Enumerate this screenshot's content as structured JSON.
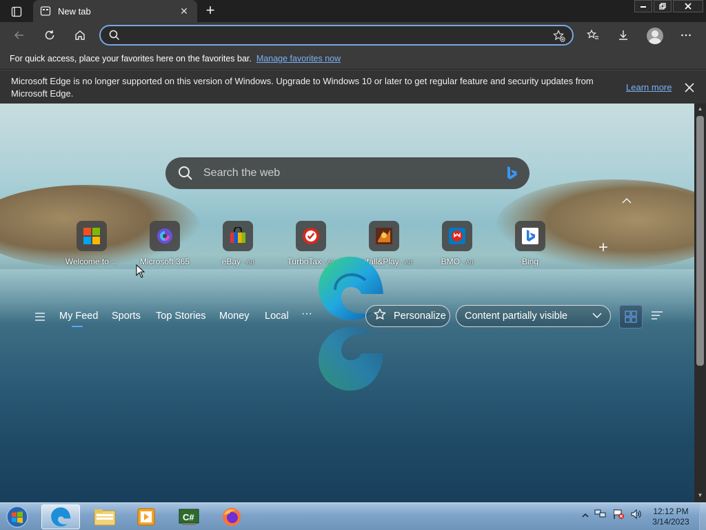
{
  "browser": {
    "tab": {
      "title": "New tab",
      "close": "✕"
    },
    "new_tab": "+",
    "window_controls": [
      "minimize",
      "restore",
      "close"
    ]
  },
  "toolbar": {
    "address_value": "",
    "icons": [
      "back-icon",
      "refresh-icon",
      "home-icon",
      "search-icon",
      "add-favorite-icon",
      "favorites-icon",
      "downloads-icon",
      "profile-avatar",
      "more-icon"
    ]
  },
  "favorites_bar": {
    "text": "For quick access, place your favorites here on the favorites bar.",
    "link": "Manage favorites now"
  },
  "infobar": {
    "message": "Microsoft Edge is no longer supported on this version of Windows. Upgrade to Windows 10 or later to get regular feature and security updates from Microsoft Edge.",
    "link": "Learn more"
  },
  "newtab": {
    "search_placeholder": "Search the web",
    "tiles": [
      {
        "label": "Welcome to ...",
        "ad": ""
      },
      {
        "label": "Microsoft 365",
        "ad": ""
      },
      {
        "label": "eBay",
        "ad": "· Ad"
      },
      {
        "label": "TurboTax",
        "ad": "· Ad"
      },
      {
        "label": "Install&Play",
        "ad": "· Ad"
      },
      {
        "label": "BMO",
        "ad": "· Ad"
      },
      {
        "label": "Bing",
        "ad": ""
      }
    ],
    "add_tile": "+",
    "feed_tabs": [
      "My Feed",
      "Sports",
      "Top Stories",
      "Money",
      "Local"
    ],
    "feed_more": "···",
    "personalize": "Personalize",
    "content_visibility": "Content partially visible"
  },
  "taskbar": {
    "apps": [
      "start-orb",
      "edge",
      "file-explorer",
      "media-player",
      "csharp-app",
      "firefox"
    ],
    "clock_time": "12:12 PM",
    "clock_date": "3/14/2023"
  },
  "colors": {
    "accent": "#7ab0f5",
    "address_border": "#7aa7e6",
    "chrome_bg": "#3b3b3b"
  }
}
